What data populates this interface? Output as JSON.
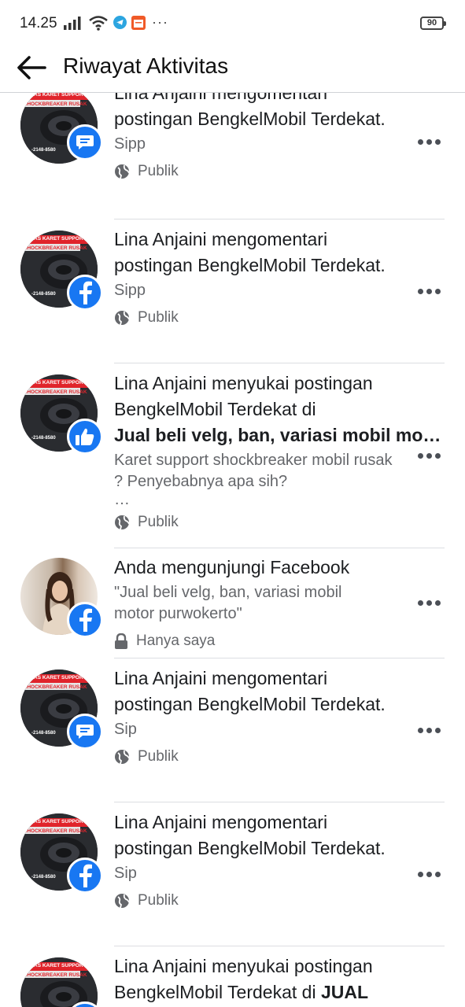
{
  "status_bar": {
    "time": "14.25",
    "battery": "90"
  },
  "header": {
    "title": "Riwayat Aktivitas"
  },
  "items": [
    {
      "headline": "Lina Anjaini mengomentari postingan BengkelMobil Terdekat.",
      "sub": "Sipp",
      "privacy": "Publik",
      "badge": "comment-icon"
    },
    {
      "headline": "Lina Anjaini mengomentari postingan BengkelMobil Terdekat.",
      "sub": "Sipp",
      "privacy": "Publik",
      "badge": "facebook-icon"
    },
    {
      "headline_pre": "Lina Anjaini menyukai postingan BengkelMobil Terdekat di ",
      "headline_bold": "Jual beli velg, ban, variasi mobil mo…",
      "sub": "Karet support shockbreaker mobil rusak ? Penyebabnya apa sih?",
      "sub_more": "…",
      "privacy": "Publik",
      "badge": "like-icon"
    },
    {
      "headline": "Anda mengunjungi Facebook",
      "sub": "\"Jual beli velg, ban, variasi mobil motor purwokerto\"",
      "privacy": "Hanya saya",
      "badge": "facebook-icon"
    },
    {
      "headline": "Lina Anjaini mengomentari postingan BengkelMobil Terdekat.",
      "sub": "Sip",
      "privacy": "Publik",
      "badge": "comment-icon"
    },
    {
      "headline": "Lina Anjaini mengomentari postingan BengkelMobil Terdekat.",
      "sub": "Sip",
      "privacy": "Publik",
      "badge": "facebook-icon"
    },
    {
      "headline_pre": "Lina Anjaini menyukai postingan BengkelMobil Terdekat di ",
      "headline_bold": "JUAL",
      "badge": "like-icon"
    }
  ],
  "thumb": {
    "banner_line1": "EBAS KARET SUPPORT",
    "banner_line2": "SHOCKBREAKER RUSAK",
    "phone": "-2148-8580"
  },
  "colors": {
    "facebook_blue": "#1877f2",
    "banner_red": "#e0242b"
  }
}
